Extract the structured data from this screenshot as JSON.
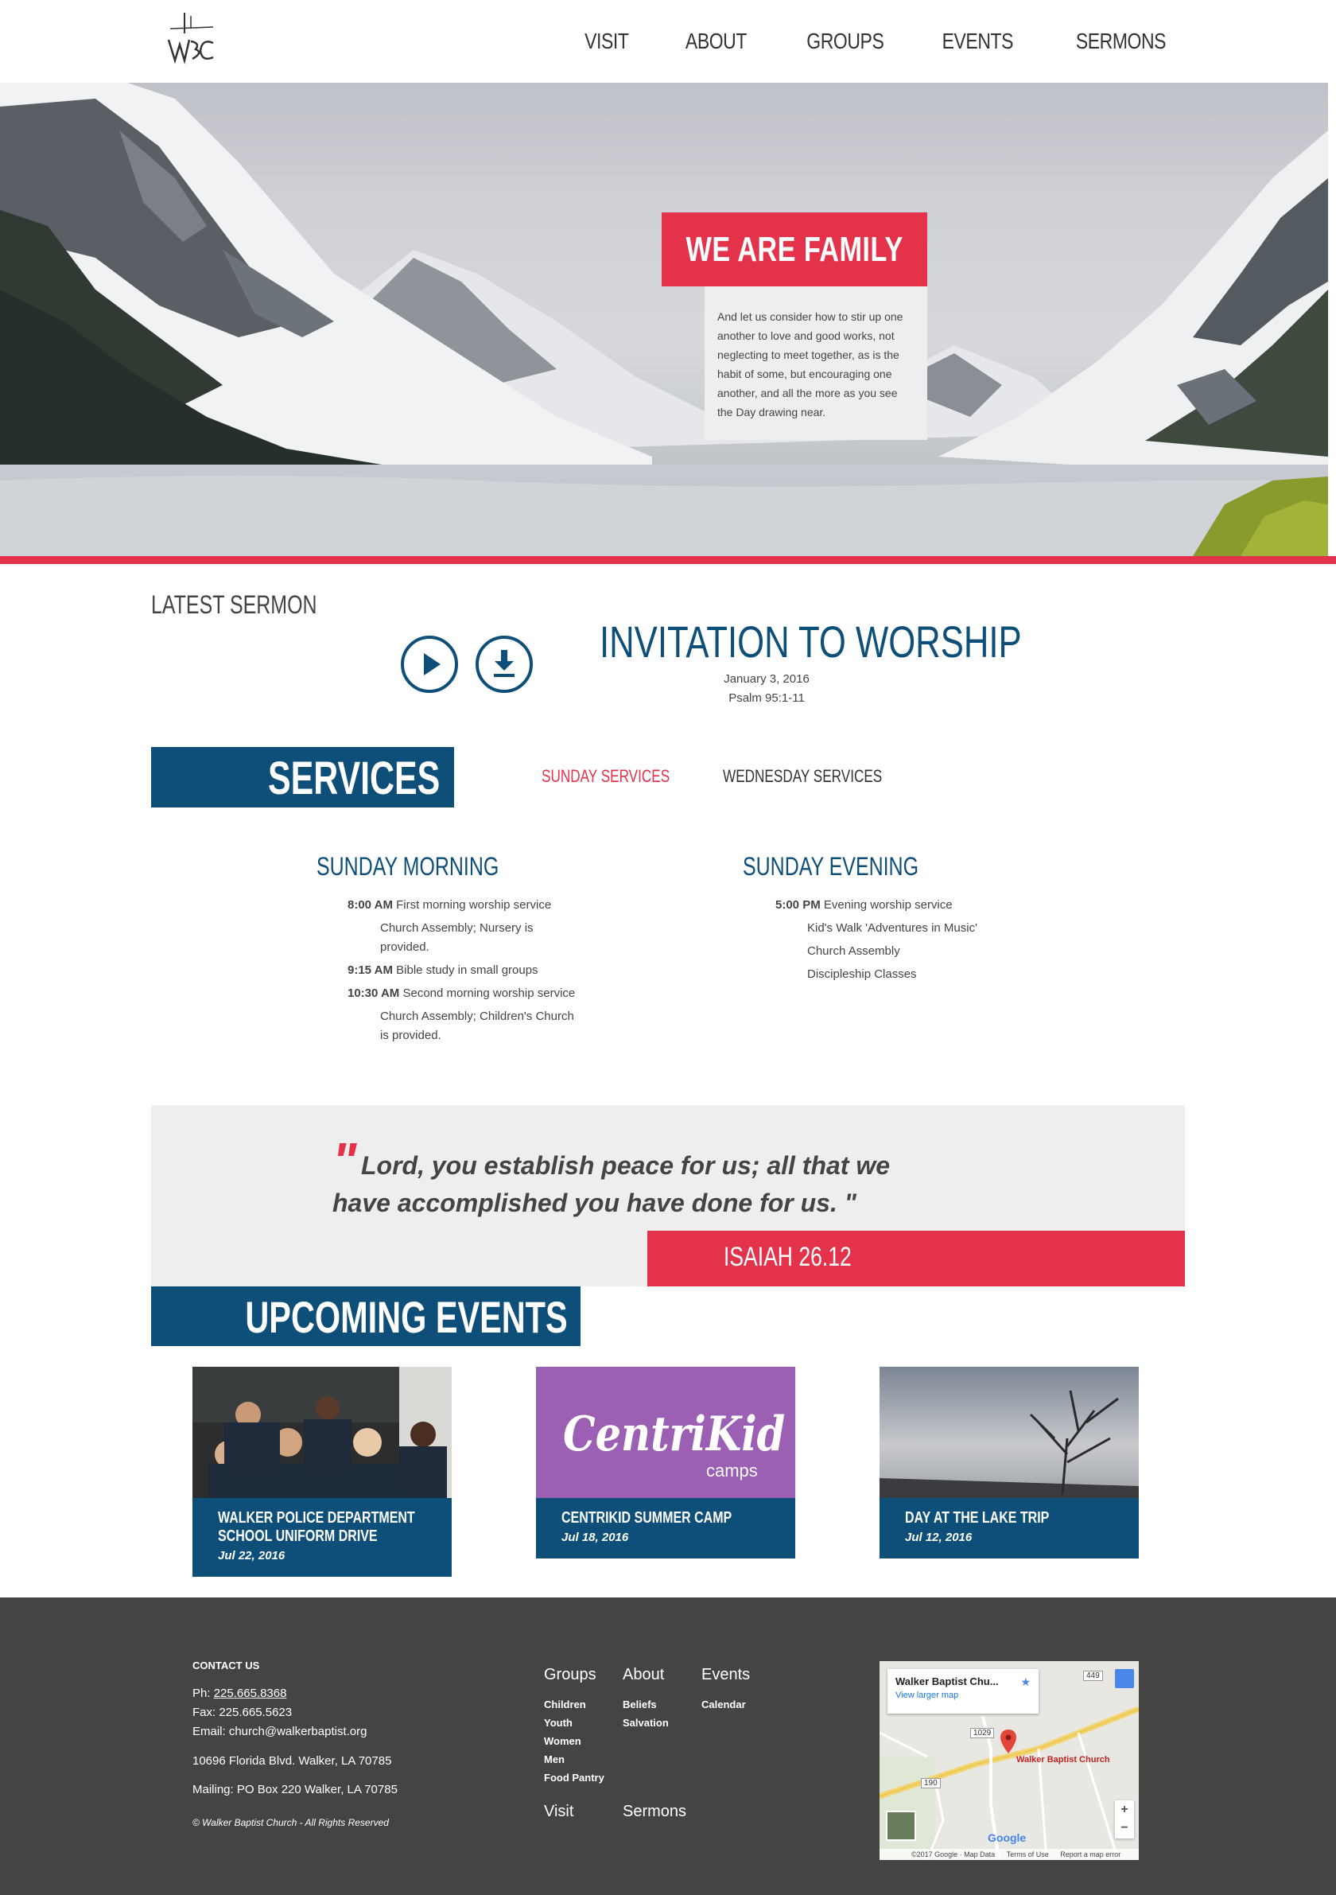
{
  "nav": {
    "items": [
      "VISIT",
      "ABOUT",
      "GROUPS",
      "EVENTS",
      "SERMONS"
    ]
  },
  "hero": {
    "title": "WE ARE FAMILY",
    "text": "And let us consider how to stir up one another to love and good works, not neglecting to meet together, as is the habit of some, but encouraging one another, and all the more as you see the Day drawing near."
  },
  "sermon": {
    "label": "LATEST SERMON",
    "title": "INVITATION TO WORSHIP",
    "date": "January 3, 2016",
    "passage": "Psalm 95:1-11"
  },
  "services": {
    "title": "SERVICES",
    "tabs": [
      "SUNDAY SERVICES",
      "WEDNESDAY SERVICES"
    ],
    "active_tab": "SUNDAY SERVICES",
    "morning": {
      "heading": "SUNDAY MORNING",
      "entries": [
        {
          "time": "8:00 AM",
          "text": " First morning worship service"
        },
        {
          "time": "",
          "text": "Church Assembly; Nursery is"
        },
        {
          "time": "",
          "text": "provided."
        },
        {
          "time": "9:15 AM",
          "text": " Bible study in small groups"
        },
        {
          "time": "10:30 AM",
          "text": " Second morning worship service"
        },
        {
          "time": "",
          "text": "Church Assembly; Children's Church"
        },
        {
          "time": "",
          "text": "is provided."
        }
      ]
    },
    "evening": {
      "heading": "SUNDAY EVENING",
      "entries": [
        {
          "time": "5:00 PM",
          "text": " Evening worship service"
        },
        {
          "time": "",
          "text": "Kid's Walk 'Adventures in Music'"
        },
        {
          "time": "",
          "text": "Church Assembly"
        },
        {
          "time": "",
          "text": "Discipleship Classes"
        }
      ]
    }
  },
  "quote": {
    "mark": "\"",
    "text": "Lord, you establish peace for us; all that we have accomplished you have done for us. \"",
    "reference": "ISAIAH 26.12"
  },
  "events": {
    "title": "UPCOMING EVENTS",
    "items": [
      {
        "title": "WALKER POLICE DEPARTMENT SCHOOL UNIFORM DRIVE",
        "date": "Jul 22, 2016"
      },
      {
        "title": "CENTRIKID SUMMER CAMP",
        "date": "Jul 18, 2016"
      },
      {
        "title": "DAY AT THE LAKE TRIP",
        "date": "Jul 12, 2016"
      }
    ],
    "centrikid_logo": "CentriKid",
    "centrikid_sub": "camps"
  },
  "footer": {
    "contact_title": "CONTACT US",
    "phone_label": "Ph: ",
    "phone": "225.665.8368",
    "fax": "Fax: 225.665.5623",
    "email": "Email: church@walkerbaptist.org",
    "address": "10696 Florida Blvd. Walker, LA 70785",
    "mailing": "Mailing: PO Box 220 Walker, LA 70785",
    "copyright": "© Walker Baptist Church - All Rights Reserved",
    "columns": {
      "groups": {
        "label": "Groups",
        "links": [
          "Children",
          "Youth",
          "Women",
          "Men",
          "Food Pantry"
        ]
      },
      "about": {
        "label": "About",
        "links": [
          "Beliefs",
          "Salvation"
        ]
      },
      "events": {
        "label": "Events",
        "links": [
          "Calendar"
        ]
      },
      "visit": {
        "label": "Visit"
      },
      "sermons": {
        "label": "Sermons"
      }
    },
    "map": {
      "place": "Walker Baptist Chu...",
      "larger": "View larger map",
      "pin_label": "Walker Baptist Church",
      "road_1029": "1029",
      "road_449": "449",
      "road_190": "190",
      "google": "Google",
      "copyright": "©2017 Google · Map Data",
      "terms": "Terms of Use",
      "report": "Report a map error",
      "zoom_in": "+",
      "zoom_out": "−"
    }
  },
  "colors": {
    "accent_red": "#e3324a",
    "brand_blue": "#0e4f79",
    "panel_gray": "#eeeeee",
    "footer_gray": "#444444"
  },
  "icons": [
    "play-icon",
    "download-icon",
    "map-pin-icon",
    "star-icon",
    "pegman-icon"
  ]
}
